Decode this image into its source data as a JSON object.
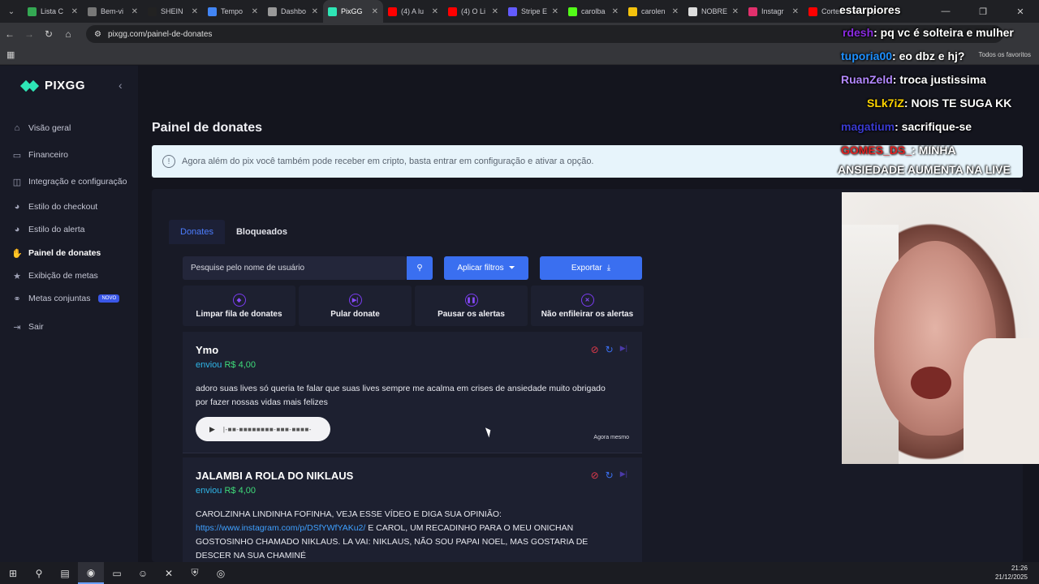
{
  "browser": {
    "tabs": [
      {
        "label": "Lista C",
        "color": "#34a853"
      },
      {
        "label": "Bem-vi",
        "color": "#777777"
      },
      {
        "label": "SHEIN",
        "color": "#222222"
      },
      {
        "label": "Tempo",
        "color": "#4285f4"
      },
      {
        "label": "Dashbo",
        "color": "#999999"
      },
      {
        "label": "PixGG",
        "color": "#2ee6b6"
      },
      {
        "label": "(4) A lu",
        "color": "#ff0000"
      },
      {
        "label": "(4) O Li",
        "color": "#ff0000"
      },
      {
        "label": "Stripe E",
        "color": "#635bff"
      },
      {
        "label": "carolba",
        "color": "#53fc18"
      },
      {
        "label": "carolen",
        "color": "#f4c20d"
      },
      {
        "label": "NOBRE",
        "color": "#dddddd"
      },
      {
        "label": "Instagr",
        "color": "#e1306c"
      },
      {
        "label": "Cortes",
        "color": "#ff0000"
      }
    ],
    "url": "pixgg.com/painel-de-donates",
    "bookmarks_label": "Todos os favoritos"
  },
  "sidebar": {
    "brand": "PIXGG",
    "items": [
      {
        "label": "Visão geral",
        "icon": "home-icon",
        "glyph": "⌂"
      },
      {
        "label": "Financeiro",
        "icon": "wallet-icon",
        "glyph": "▭"
      },
      {
        "label": "Integração e configuração",
        "icon": "integration-icon",
        "glyph": "◫"
      },
      {
        "label": "Estilo do checkout",
        "icon": "palette-icon",
        "glyph": "◕"
      },
      {
        "label": "Estilo do alerta",
        "icon": "alert-style-icon",
        "glyph": "◕"
      },
      {
        "label": "Painel de donates",
        "icon": "donate-icon",
        "glyph": "✋"
      },
      {
        "label": "Exibição de metas",
        "icon": "star-icon",
        "glyph": "★"
      },
      {
        "label": "Metas conjuntas",
        "icon": "shared-goals-icon",
        "glyph": "⚭",
        "badge": "NOVO"
      },
      {
        "label": "Sair",
        "icon": "logout-icon",
        "glyph": "⇥"
      }
    ]
  },
  "main": {
    "title": "Painel de donates",
    "notice": "Agora além do pix você também pode receber em cripto, basta entrar em configuração e ativar a opção.",
    "tabs": [
      "Donates",
      "Bloqueados"
    ],
    "search_placeholder": "Pesquise pelo nome de usuário",
    "filter_label": "Aplicar filtros",
    "export_label": "Exportar",
    "actions": [
      {
        "label": "Limpar fila de donates",
        "icon": "eraser-icon",
        "glyph": "◆"
      },
      {
        "label": "Pular donate",
        "icon": "skip-icon",
        "glyph": "▶|"
      },
      {
        "label": "Pausar os alertas",
        "icon": "pause-icon",
        "glyph": "❚❚"
      },
      {
        "label": "Não enfileirar os alertas",
        "icon": "bell-off-icon",
        "glyph": "✕"
      }
    ],
    "donates": [
      {
        "name": "Ymo",
        "sent": "enviou",
        "amount": "R$ 4,00",
        "message": "adoro suas lives só queria te falar que suas lives sempre me acalma em crises de ansiedade muito obrigado por fazer nossas vidas mais felizes",
        "audio_wave": "|-■■-■■■■■■■■-■■■-■■■■-",
        "time": "Agora mesmo"
      },
      {
        "name": "JALAMBI A ROLA DO NIKLAUS",
        "sent": "enviou",
        "amount": "R$ 4,00",
        "message_start": "CAROLZINHA LINDINHA FOFINHA, VEJA ESSE VÍDEO E DIGA SUA OPINIÃO:",
        "message_link": "https://www.instagram.com/p/DSfYWfYAKu2/",
        "message_end": " E CAROL, UM RECADINHO PARA O MEU ONICHAN GOSTOSINHO CHAMADO NIKLAUS. LA VAI: NIKLAUS, NÃO SOU PAPAI NOEL, MAS GOSTARIA DE DESCER NA SUA CHAMINÉ"
      }
    ]
  },
  "stream_chat": [
    {
      "user": "",
      "text": "estarpiores",
      "color": "#ffffff"
    },
    {
      "user": "rdesh",
      "text": ": pq vc é solteira e mulher",
      "color": "#8a2be2"
    },
    {
      "user": "tuporia00",
      "text": ": eo dbz e hj?",
      "color": "#1e90ff"
    },
    {
      "user": "RuanZeld",
      "text": ": troca justissima",
      "color": "#b388ff"
    },
    {
      "user": "SLk7iZ",
      "text": ": NOIS TE SUGA KK",
      "color": "#ffd400"
    },
    {
      "user": "magatium",
      "text": ": sacrifique-se",
      "color": "#3a3ad0"
    },
    {
      "user": "GOMES_DS_",
      "text": ": MINHA",
      "color": "#e02020"
    },
    {
      "user": "",
      "text": "ANSIEDADE AUMENTA NA LIVE",
      "color": "#ffffff"
    }
  ],
  "taskbar": {
    "time": "21:26",
    "date": "21/12/2025"
  }
}
